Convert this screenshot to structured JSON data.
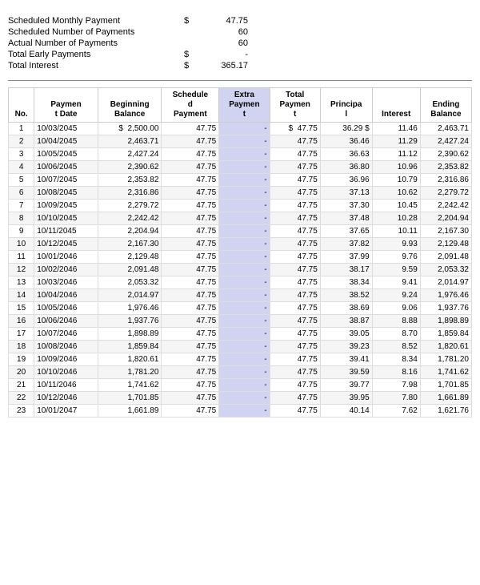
{
  "summary": {
    "rows": [
      {
        "label": "Scheduled Monthly Payment",
        "currency": "$",
        "value": "47.75"
      },
      {
        "label": "Scheduled Number of Payments",
        "currency": "",
        "value": "60"
      },
      {
        "label": "Actual Number of Payments",
        "currency": "",
        "value": "60"
      },
      {
        "label": "Total Early Payments",
        "currency": "$",
        "value": "-"
      },
      {
        "label": "Total Interest",
        "currency": "$",
        "value": "365.17"
      }
    ]
  },
  "table": {
    "headers": [
      {
        "id": "no",
        "lines": [
          "No."
        ]
      },
      {
        "id": "payment-date",
        "lines": [
          "Paymen",
          "t Date"
        ]
      },
      {
        "id": "beginning-balance",
        "lines": [
          "Beginning",
          "Balance"
        ]
      },
      {
        "id": "scheduled-payment",
        "lines": [
          "Schedule",
          "d",
          "Payment"
        ]
      },
      {
        "id": "extra-payment",
        "lines": [
          "Extra",
          "Paymen",
          "t"
        ],
        "extra": true
      },
      {
        "id": "total-payment",
        "lines": [
          "Total",
          "Paymen",
          "t"
        ]
      },
      {
        "id": "principal",
        "lines": [
          "Principa",
          "l"
        ]
      },
      {
        "id": "interest",
        "lines": [
          "Interest"
        ]
      },
      {
        "id": "ending-balance",
        "lines": [
          "Ending",
          "Balance"
        ]
      }
    ],
    "rows": [
      {
        "no": 1,
        "date": "10/03/2045",
        "beg": "2,500.00",
        "sched": "47.75",
        "extra": "-",
        "total": "47.75",
        "principal": "36.29",
        "interest": "11.46",
        "ending": "2,463.71",
        "hasDollar": true
      },
      {
        "no": 2,
        "date": "10/04/2045",
        "beg": "2,463.71",
        "sched": "47.75",
        "extra": "-",
        "total": "47.75",
        "principal": "36.46",
        "interest": "11.29",
        "ending": "2,427.24"
      },
      {
        "no": 3,
        "date": "10/05/2045",
        "beg": "2,427.24",
        "sched": "47.75",
        "extra": "-",
        "total": "47.75",
        "principal": "36.63",
        "interest": "11.12",
        "ending": "2,390.62"
      },
      {
        "no": 4,
        "date": "10/06/2045",
        "beg": "2,390.62",
        "sched": "47.75",
        "extra": "-",
        "total": "47.75",
        "principal": "36.80",
        "interest": "10.96",
        "ending": "2,353.82"
      },
      {
        "no": 5,
        "date": "10/07/2045",
        "beg": "2,353.82",
        "sched": "47.75",
        "extra": "-",
        "total": "47.75",
        "principal": "36.96",
        "interest": "10.79",
        "ending": "2,316.86"
      },
      {
        "no": 6,
        "date": "10/08/2045",
        "beg": "2,316.86",
        "sched": "47.75",
        "extra": "-",
        "total": "47.75",
        "principal": "37.13",
        "interest": "10.62",
        "ending": "2,279.72"
      },
      {
        "no": 7,
        "date": "10/09/2045",
        "beg": "2,279.72",
        "sched": "47.75",
        "extra": "-",
        "total": "47.75",
        "principal": "37.30",
        "interest": "10.45",
        "ending": "2,242.42"
      },
      {
        "no": 8,
        "date": "10/10/2045",
        "beg": "2,242.42",
        "sched": "47.75",
        "extra": "-",
        "total": "47.75",
        "principal": "37.48",
        "interest": "10.28",
        "ending": "2,204.94"
      },
      {
        "no": 9,
        "date": "10/11/2045",
        "beg": "2,204.94",
        "sched": "47.75",
        "extra": "-",
        "total": "47.75",
        "principal": "37.65",
        "interest": "10.11",
        "ending": "2,167.30"
      },
      {
        "no": 10,
        "date": "10/12/2045",
        "beg": "2,167.30",
        "sched": "47.75",
        "extra": "-",
        "total": "47.75",
        "principal": "37.82",
        "interest": "9.93",
        "ending": "2,129.48"
      },
      {
        "no": 11,
        "date": "10/01/2046",
        "beg": "2,129.48",
        "sched": "47.75",
        "extra": "-",
        "total": "47.75",
        "principal": "37.99",
        "interest": "9.76",
        "ending": "2,091.48"
      },
      {
        "no": 12,
        "date": "10/02/2046",
        "beg": "2,091.48",
        "sched": "47.75",
        "extra": "-",
        "total": "47.75",
        "principal": "38.17",
        "interest": "9.59",
        "ending": "2,053.32"
      },
      {
        "no": 13,
        "date": "10/03/2046",
        "beg": "2,053.32",
        "sched": "47.75",
        "extra": "-",
        "total": "47.75",
        "principal": "38.34",
        "interest": "9.41",
        "ending": "2,014.97"
      },
      {
        "no": 14,
        "date": "10/04/2046",
        "beg": "2,014.97",
        "sched": "47.75",
        "extra": "-",
        "total": "47.75",
        "principal": "38.52",
        "interest": "9.24",
        "ending": "1,976.46"
      },
      {
        "no": 15,
        "date": "10/05/2046",
        "beg": "1,976.46",
        "sched": "47.75",
        "extra": "-",
        "total": "47.75",
        "principal": "38.69",
        "interest": "9.06",
        "ending": "1,937.76"
      },
      {
        "no": 16,
        "date": "10/06/2046",
        "beg": "1,937.76",
        "sched": "47.75",
        "extra": "-",
        "total": "47.75",
        "principal": "38.87",
        "interest": "8.88",
        "ending": "1,898.89"
      },
      {
        "no": 17,
        "date": "10/07/2046",
        "beg": "1,898.89",
        "sched": "47.75",
        "extra": "-",
        "total": "47.75",
        "principal": "39.05",
        "interest": "8.70",
        "ending": "1,859.84"
      },
      {
        "no": 18,
        "date": "10/08/2046",
        "beg": "1,859.84",
        "sched": "47.75",
        "extra": "-",
        "total": "47.75",
        "principal": "39.23",
        "interest": "8.52",
        "ending": "1,820.61"
      },
      {
        "no": 19,
        "date": "10/09/2046",
        "beg": "1,820.61",
        "sched": "47.75",
        "extra": "-",
        "total": "47.75",
        "principal": "39.41",
        "interest": "8.34",
        "ending": "1,781.20"
      },
      {
        "no": 20,
        "date": "10/10/2046",
        "beg": "1,781.20",
        "sched": "47.75",
        "extra": "-",
        "total": "47.75",
        "principal": "39.59",
        "interest": "8.16",
        "ending": "1,741.62"
      },
      {
        "no": 21,
        "date": "10/11/2046",
        "beg": "1,741.62",
        "sched": "47.75",
        "extra": "-",
        "total": "47.75",
        "principal": "39.77",
        "interest": "7.98",
        "ending": "1,701.85"
      },
      {
        "no": 22,
        "date": "10/12/2046",
        "beg": "1,701.85",
        "sched": "47.75",
        "extra": "-",
        "total": "47.75",
        "principal": "39.95",
        "interest": "7.80",
        "ending": "1,661.89"
      },
      {
        "no": 23,
        "date": "10/01/2047",
        "beg": "1,661.89",
        "sched": "47.75",
        "extra": "-",
        "total": "47.75",
        "principal": "40.14",
        "interest": "7.62",
        "ending": "1,621.76"
      }
    ]
  }
}
